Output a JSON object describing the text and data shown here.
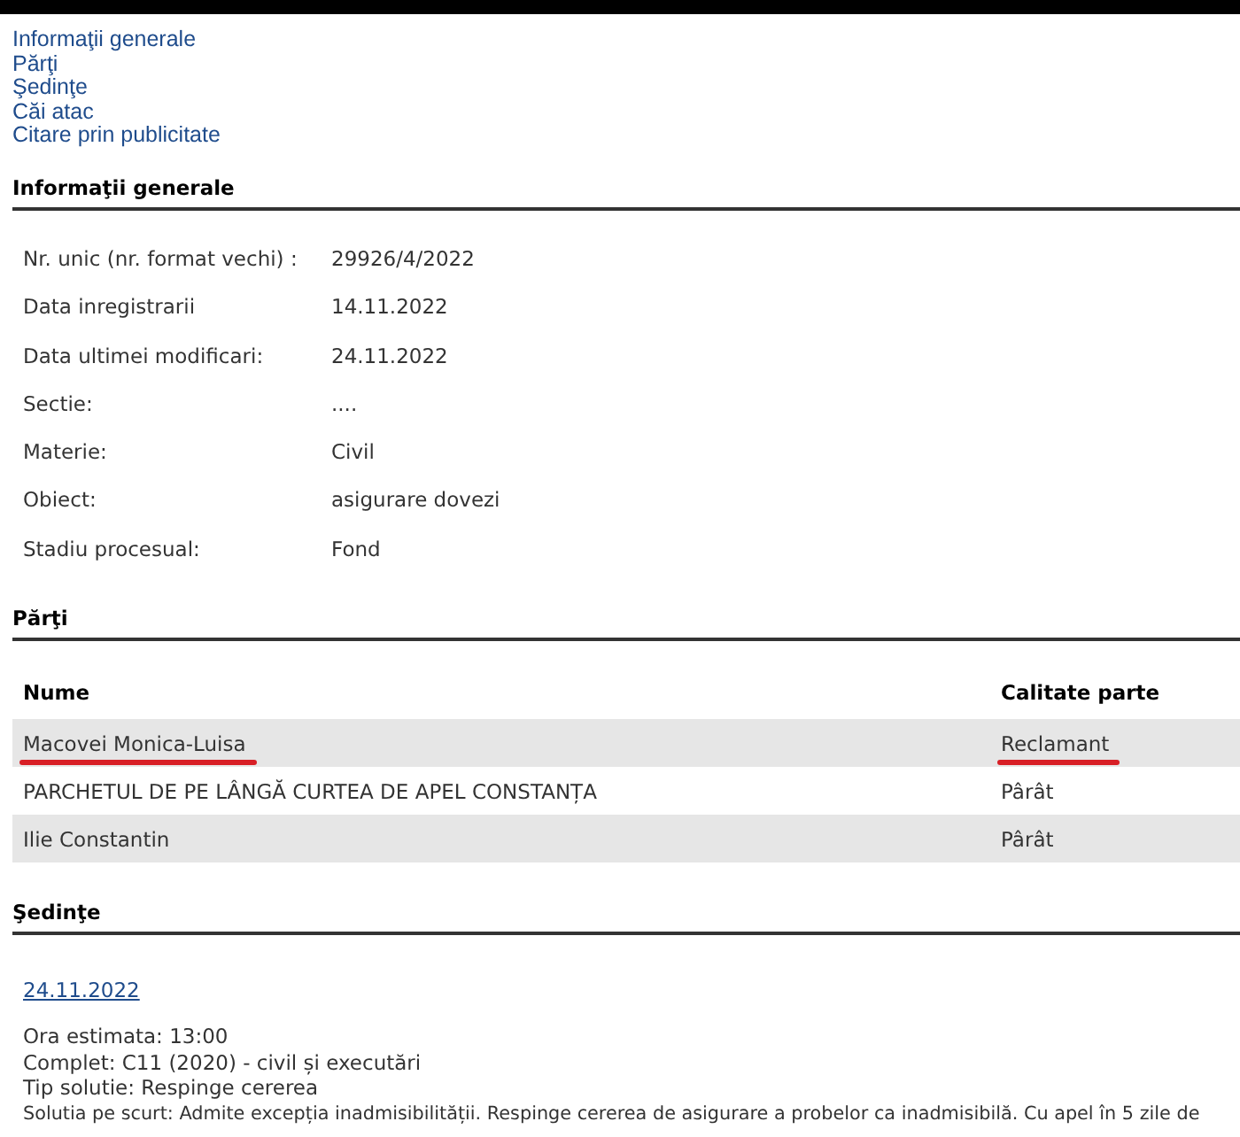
{
  "nav_links": [
    "Informaţii generale",
    "Părţi",
    "Şedinţe",
    "Căi atac",
    "Citare prin publicitate"
  ],
  "general": {
    "heading": "Informaţii generale",
    "fields": [
      {
        "label": "Nr. unic (nr. format vechi) :",
        "value": "29926/4/2022"
      },
      {
        "label": "Data inregistrarii",
        "value": "14.11.2022"
      },
      {
        "label": "Data ultimei modificari:",
        "value": "24.11.2022"
      },
      {
        "label": "Sectie:",
        "value": "...."
      },
      {
        "label": "Materie:",
        "value": "Civil"
      },
      {
        "label": "Obiect:",
        "value": "asigurare dovezi"
      },
      {
        "label": "Stadiu procesual:",
        "value": "Fond"
      }
    ]
  },
  "parties": {
    "heading": "Părţi",
    "columns": [
      "Nume",
      "Calitate parte"
    ],
    "rows": [
      {
        "name": "Macovei Monica-Luisa",
        "role": "Reclamant",
        "underlined": true
      },
      {
        "name": "PARCHETUL DE PE LÂNGĂ CURTEA DE APEL CONSTANȚA",
        "role": "Pârât",
        "underlined": false
      },
      {
        "name": "Ilie Constantin",
        "role": "Pârât",
        "underlined": false
      }
    ]
  },
  "hearings": {
    "heading": "Şedinţe",
    "date": "24.11.2022",
    "lines": [
      "Ora estimata: 13:00",
      "Complet: C11 (2020) - civil și executări",
      "Tip solutie: Respinge cererea",
      "Solutia pe scurt: Admite excepția inadmisibilității. Respinge cererea de asigurare a probelor ca inadmisibilă. Cu apel în 5 zile de"
    ]
  }
}
